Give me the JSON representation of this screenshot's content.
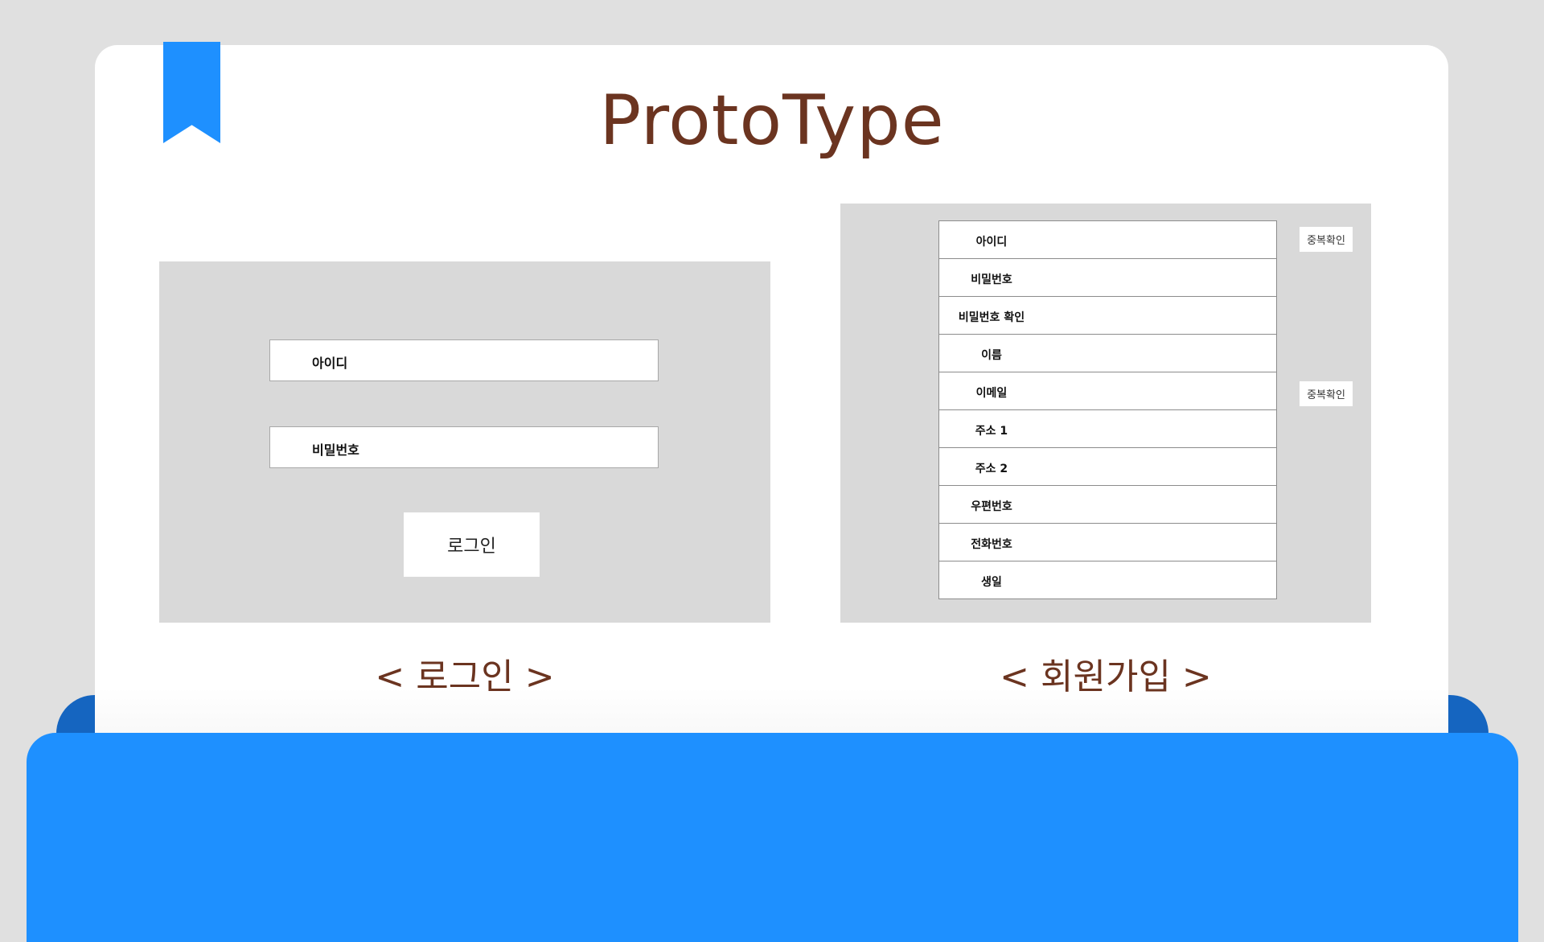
{
  "title": "ProtoType",
  "login": {
    "id_placeholder": "아이디",
    "password_placeholder": "비밀번호",
    "button_label": "로그인",
    "caption": "< 로그인 >"
  },
  "signup": {
    "fields": [
      {
        "label": "아이디"
      },
      {
        "label": "비밀번호"
      },
      {
        "label": "비밀번호 확인"
      },
      {
        "label": "이름"
      },
      {
        "label": "이메일"
      },
      {
        "label": "주소 1"
      },
      {
        "label": "주소 2"
      },
      {
        "label": "우편번호"
      },
      {
        "label": "전화번호"
      },
      {
        "label": "생일"
      }
    ],
    "dup_check_id_label": "중복확인",
    "dup_check_email_label": "중복확인",
    "caption": "< 회원가입 >"
  },
  "colors": {
    "accent_blue": "#1e90ff",
    "dark_blue": "#1565c0",
    "title_brown": "#6b3420",
    "panel_gray": "#d9d9d9"
  },
  "icons": {
    "bookmark": "bookmark-icon"
  }
}
